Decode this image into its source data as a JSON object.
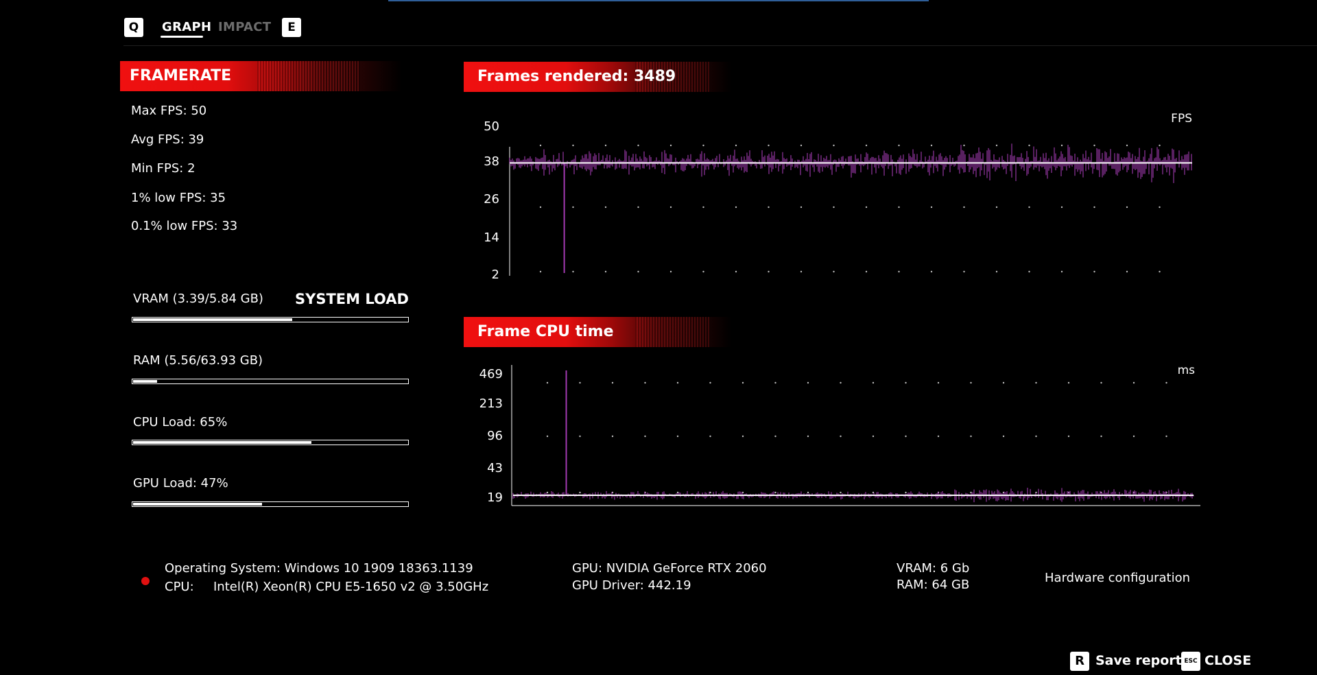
{
  "tabs": {
    "prev_key": "Q",
    "next_key": "E",
    "items": [
      {
        "label": "GRAPH",
        "active": true
      },
      {
        "label": "IMPACT",
        "active": false
      }
    ]
  },
  "framerate": {
    "title": "FRAMERATE",
    "stats": {
      "max": "Max FPS: 50",
      "avg": "Avg FPS: 39",
      "min": "Min FPS: 2",
      "low1": "1% low FPS: 35",
      "low01": "0.1% low FPS: 33"
    }
  },
  "system_load": {
    "title": "SYSTEM LOAD",
    "vram": {
      "label": "VRAM (3.39/5.84 GB)",
      "fraction": 0.58
    },
    "ram": {
      "label": "RAM (5.56/63.93 GB)",
      "fraction": 0.087
    },
    "cpu": {
      "label": "CPU Load: 65%",
      "fraction": 0.65
    },
    "gpu": {
      "label": "GPU Load: 47%",
      "fraction": 0.47
    }
  },
  "charts": {
    "fps": {
      "title": "Frames rendered: 3489",
      "unit": "FPS",
      "ticks": [
        "50",
        "38",
        "26",
        "14",
        "2"
      ]
    },
    "cpu": {
      "title": "Frame CPU time",
      "unit": "ms",
      "ticks": [
        "469",
        "213",
        "96",
        "43",
        "19"
      ]
    }
  },
  "chart_data": [
    {
      "type": "line",
      "title": "Frames rendered: 3489",
      "ylabel": "FPS",
      "yticks": [
        50,
        38,
        26,
        14,
        2
      ],
      "ylim": [
        2,
        50
      ],
      "average_line": 38,
      "frames": 3489,
      "typical_range": [
        34,
        44
      ],
      "spike_min": {
        "x_fraction": 0.08,
        "value": 2
      }
    },
    {
      "type": "line",
      "title": "Frame CPU time",
      "ylabel": "ms",
      "yticks": [
        469,
        213,
        96,
        43,
        19
      ],
      "scale": "log",
      "ylim": [
        19,
        469
      ],
      "baseline": 19,
      "spike_max": {
        "x_fraction": 0.08,
        "value": 469
      }
    }
  ],
  "hardware": {
    "os": "Operating System: Windows 10 1909 18363.1139",
    "cpu_label": "CPU:",
    "cpu_value": "Intel(R) Xeon(R) CPU E5-1650 v2 @ 3.50GHz",
    "gpu": "GPU: NVIDIA GeForce RTX 2060",
    "gpu_driver": "GPU Driver: 442.19",
    "vram": "VRAM: 6 Gb",
    "ram": "RAM: 64 GB",
    "config_label": "Hardware configuration"
  },
  "footer": {
    "save_key": "R",
    "save_label": "Save report",
    "close_key": "ESC",
    "close_label": "CLOSE"
  },
  "colors": {
    "accent_red": "#e01010",
    "series_purple": "#a13ab0",
    "background": "#000000"
  }
}
